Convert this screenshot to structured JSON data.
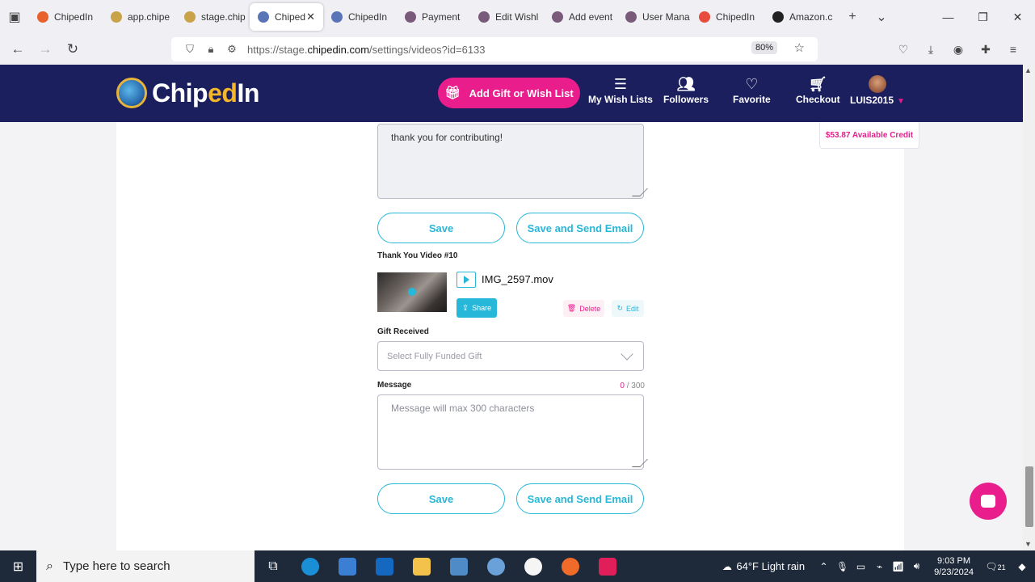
{
  "browser": {
    "tabs": [
      {
        "label": "ChipedIn",
        "color": "#e8612c"
      },
      {
        "label": "app.chipe",
        "color": "#c9a34a"
      },
      {
        "label": "stage.chip",
        "color": "#c9a34a"
      },
      {
        "label": "Chiped",
        "color": "#5a74b8",
        "active": true
      },
      {
        "label": "ChipedIn",
        "color": "#5a74b8"
      },
      {
        "label": "Payment",
        "color": "#7a5a7a"
      },
      {
        "label": "Edit Wishl",
        "color": "#7a5a7a"
      },
      {
        "label": "Add event",
        "color": "#7a5a7a"
      },
      {
        "label": "User Mana",
        "color": "#7a5a7a"
      },
      {
        "label": "ChipedIn",
        "color": "#e84c3d"
      },
      {
        "label": "Amazon.c",
        "color": "#222222"
      }
    ],
    "url_prefix": "https://stage.",
    "url_host": "chipedin.com",
    "url_path": "/settings/videos?id=6133",
    "zoom": "80%"
  },
  "header": {
    "logo_chip": "Chip",
    "logo_ed": "ed",
    "logo_in": "In",
    "add_gift": "Add Gift or Wish List",
    "nav": [
      {
        "label": "My Wish Lists",
        "icon": "list-icon"
      },
      {
        "label": "Followers",
        "icon": "followers-icon"
      },
      {
        "label": "Favorite",
        "icon": "heart-icon"
      },
      {
        "label": "Checkout",
        "icon": "cart-icon"
      }
    ],
    "user": "LUIS2015",
    "credit": "$53.87 Available Credit"
  },
  "form": {
    "message_value": "thank you for contributing!",
    "save": "Save",
    "save_send": "Save and Send Email",
    "video_title": "Thank You Video #10",
    "filename": "IMG_2597.mov",
    "share": "Share",
    "delete": "Delete",
    "edit": "Edit",
    "gift_label": "Gift Received",
    "gift_placeholder": "Select Fully Funded Gift",
    "message_label": "Message",
    "counter_current": "0",
    "counter_max": " / 300",
    "message_placeholder": "Message will max 300 characters"
  },
  "taskbar": {
    "search": "Type here to search",
    "weather": "64°F  Light rain",
    "time": "9:03 PM",
    "date": "9/23/2024",
    "notif": "21"
  },
  "colors": {
    "brand_navy": "#1b1f5e",
    "accent_pink": "#e91e8c",
    "accent_cyan": "#27b7d8"
  }
}
